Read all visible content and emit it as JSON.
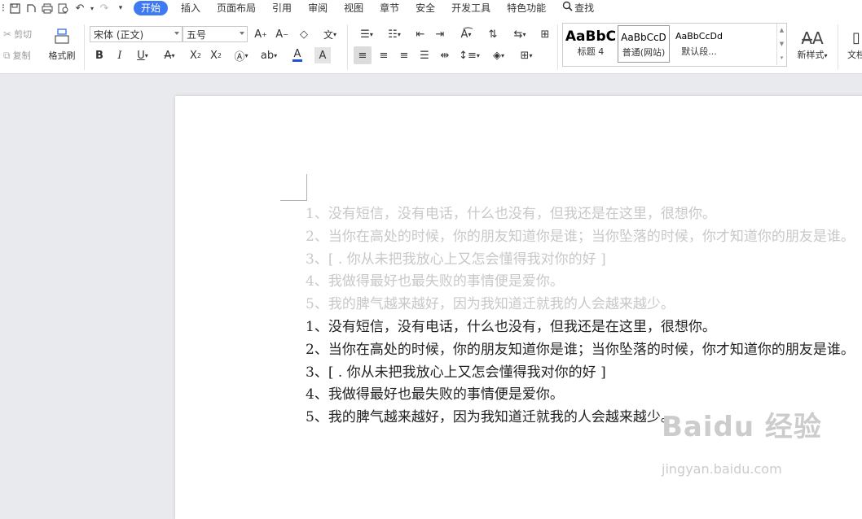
{
  "menubar": {
    "quick_icons": [
      "menu-partial-icon",
      "save-icon",
      "print-preview-icon",
      "print-icon",
      "preview-icon",
      "undo-icon",
      "redo-icon",
      "customize-icon"
    ],
    "items": [
      "开始",
      "插入",
      "页面布局",
      "引用",
      "审阅",
      "视图",
      "章节",
      "安全",
      "开发工具",
      "特色功能"
    ],
    "active": "开始",
    "search_label": "查找"
  },
  "ribbon": {
    "cut_label": "剪切",
    "copy_label": "复制",
    "format_painter_label": "格式刷",
    "font_name": "宋体 (正文)",
    "font_size": "五号",
    "styles": [
      {
        "preview": "AaBbC",
        "label": "标题 4"
      },
      {
        "preview": "AaBbCcD",
        "label": "普通(网站)"
      },
      {
        "preview": "AaBbCcDd",
        "label": "默认段..."
      }
    ],
    "new_style_label": "新样式",
    "doc_label": "文档"
  },
  "document": {
    "faded_lines": [
      "1、没有短信，没有电话，什么也没有，但我还是在这里，很想你。",
      "2、当你在高处的时候，你的朋友知道你是谁；当你坠落的时候，你才知道你的朋友是谁。",
      "3、[          . 你从未把我放心上又怎会懂得我对你的好       ]",
      "4、我做得最好也最失败的事情便是爱你。",
      "5、我的脾气越来越好，因为我知道迁就我的人会越来越少。"
    ],
    "lines": [
      "1、没有短信，没有电话，什么也没有，但我还是在这里，很想你。",
      "2、当你在高处的时候，你的朋友知道你是谁；当你坠落的时候，你才知道你的朋友是谁。",
      "3、[          . 你从未把我放心上又怎会懂得我对你的好       ]",
      "4、我做得最好也最失败的事情便是爱你。",
      "5、我的脾气越来越好，因为我知道迁就我的人会越来越少。"
    ]
  },
  "watermark": {
    "brand": "Baidu 经验",
    "url": "jingyan.baidu.com"
  },
  "colors": {
    "accent": "#3f7af3",
    "faded_text": "#c8c8c8",
    "font_color_bar": "#2050e0"
  }
}
